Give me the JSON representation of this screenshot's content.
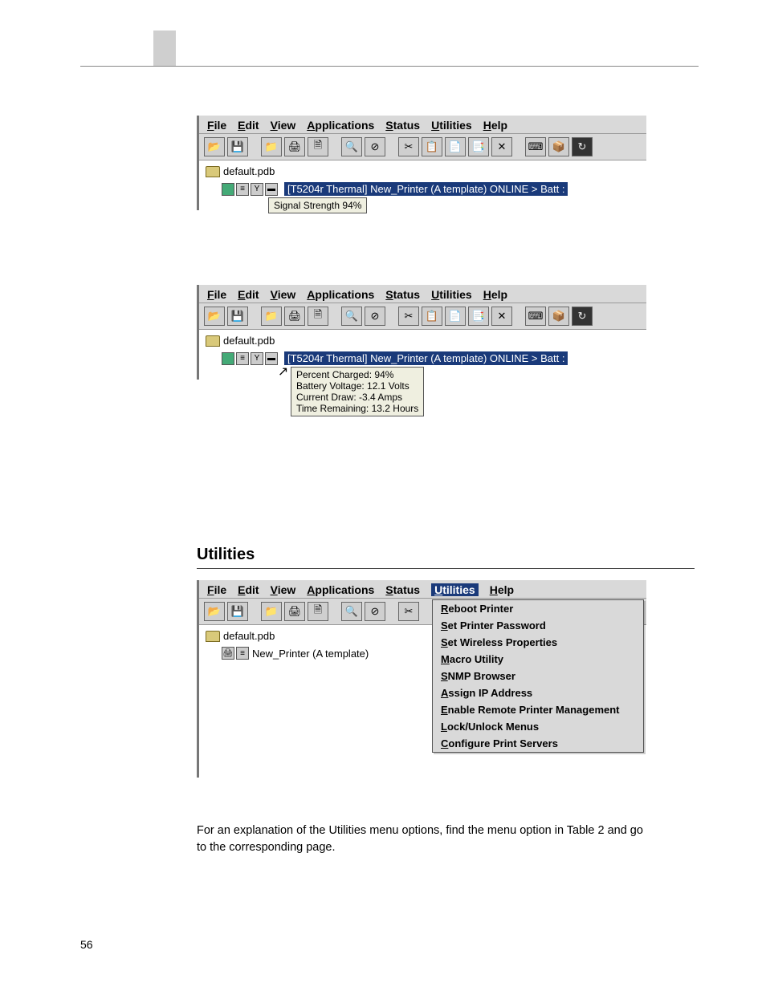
{
  "menubar": [
    "File",
    "Edit",
    "View",
    "Applications",
    "Status",
    "Utilities",
    "Help"
  ],
  "toolbar_groups": [
    [
      "open-icon",
      "save-icon"
    ],
    [
      "folder-new-icon",
      "print-icon",
      "doc-icon"
    ],
    [
      "find-icon",
      "cancel-icon"
    ],
    [
      "cut-icon",
      "copy-icon",
      "paste-icon",
      "paste2-icon",
      "delete-icon"
    ],
    [
      "keyboard-icon",
      "package-icon",
      "refresh-icon"
    ]
  ],
  "toolbar_glyphs": {
    "open-icon": "📂",
    "save-icon": "💾",
    "folder-new-icon": "📁",
    "print-icon": "🖨",
    "doc-icon": "🗎",
    "find-icon": "🔍",
    "cancel-icon": "⊘",
    "cut-icon": "✂",
    "copy-icon": "📋",
    "paste-icon": "📄",
    "paste2-icon": "📑",
    "delete-icon": "✕",
    "keyboard-icon": "⌨",
    "package-icon": "📦",
    "refresh-icon": "↻"
  },
  "fig1": {
    "db_file": "default.pdb",
    "printer_label": "[T5204r Thermal] New_Printer (A template) ONLINE > Batt :",
    "tooltip": "Signal Strength 94%"
  },
  "fig2": {
    "db_file": "default.pdb",
    "printer_label": "[T5204r Thermal] New_Printer (A template) ONLINE > Batt :",
    "tooltip": "Percent Charged: 94%\nBattery Voltage: 12.1 Volts\nCurrent Draw: -3.4 Amps\nTime Remaining: 13.2 Hours"
  },
  "fig3": {
    "db_file": "default.pdb",
    "printer_label": "New_Printer (A template)",
    "menu_selected": "Utilities",
    "dropdown": [
      "Reboot Printer",
      "Set Printer Password",
      "Set Wireless Properties",
      "Macro Utility",
      "SNMP Browser",
      "Assign IP Address",
      "Enable Remote Printer Management",
      "Lock/Unlock Menus",
      "Configure Print Servers"
    ],
    "underlines": [
      "R",
      "S",
      "W",
      "M",
      "SN",
      "A",
      "E",
      "L",
      "C"
    ]
  },
  "section_header": "Utilities",
  "body_text": "For an explanation of the Utilities menu options, find the menu option in Table 2 and go to the corresponding page.",
  "page_number": "56"
}
